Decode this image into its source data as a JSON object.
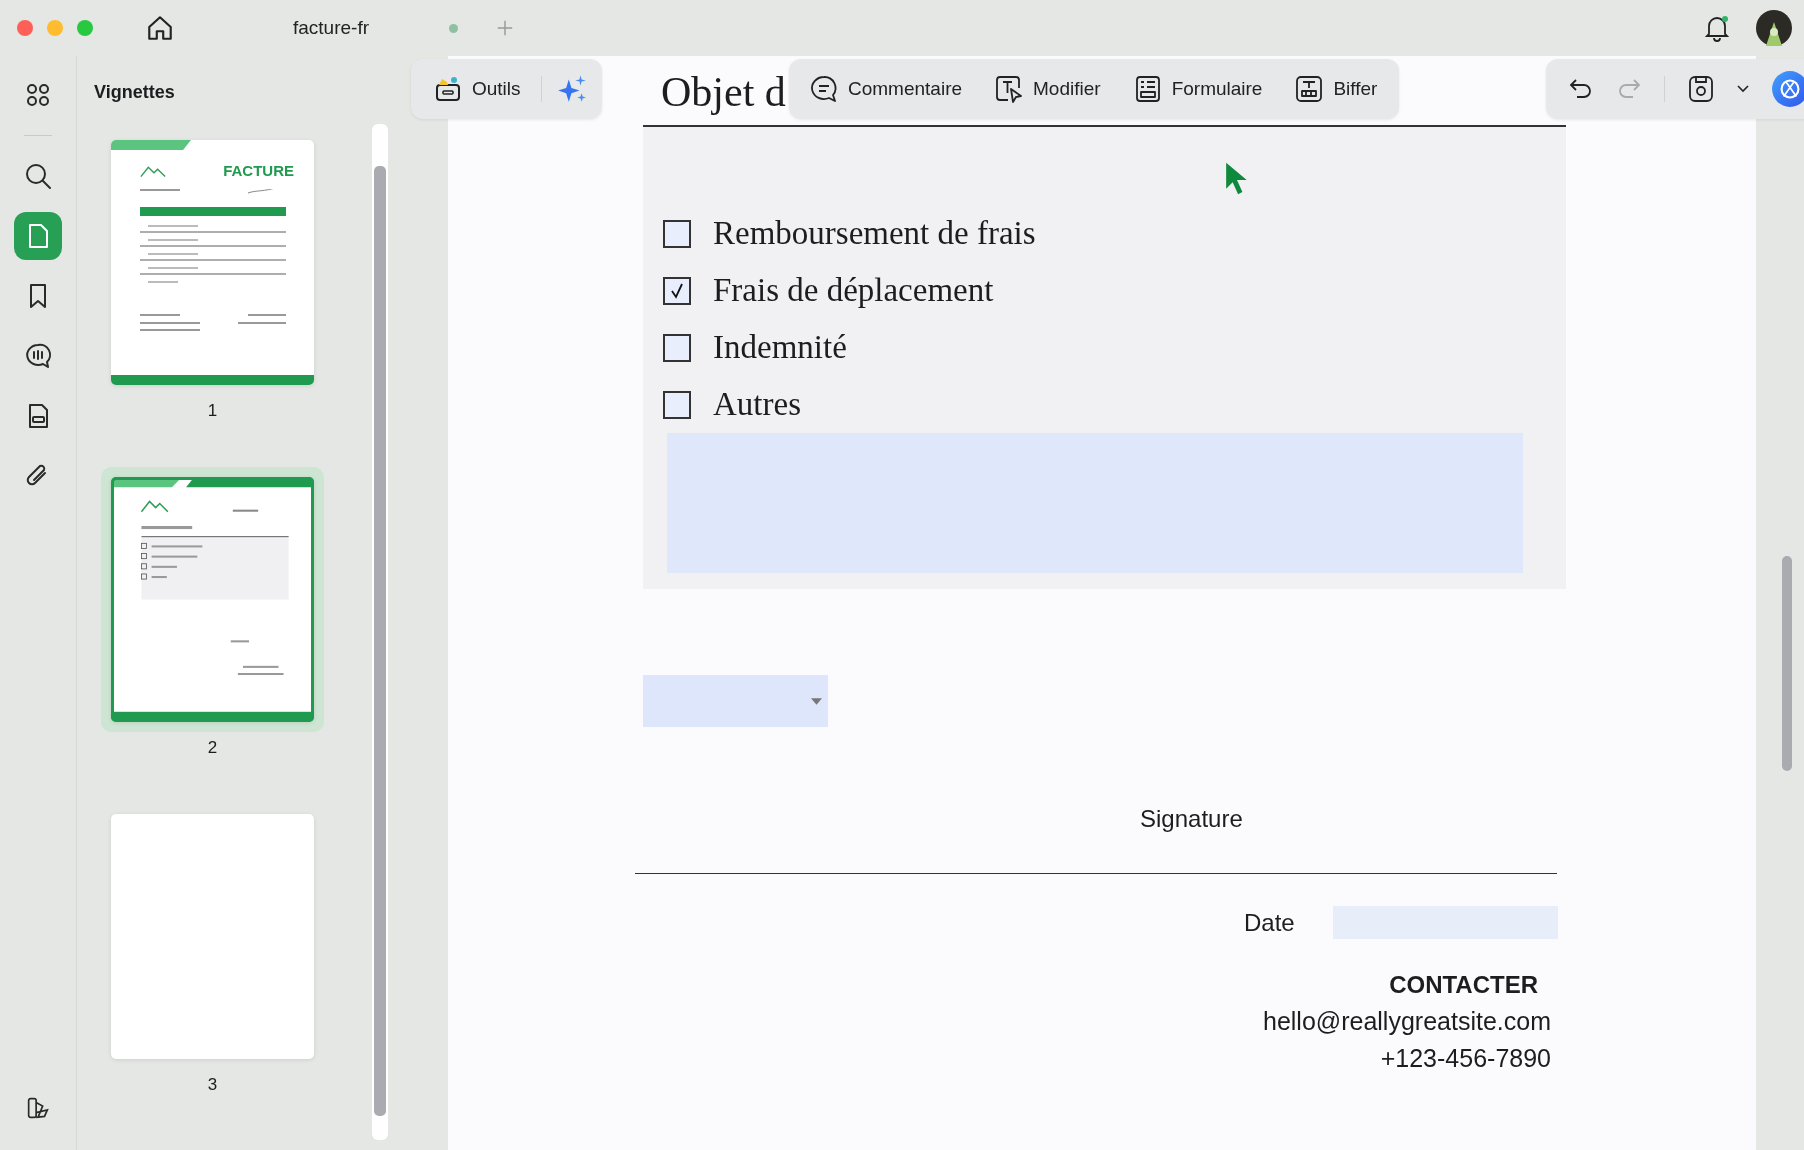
{
  "window": {
    "tab_title": "facture-fr",
    "tab_unsaved": true
  },
  "rail": [
    {
      "kind": "grid",
      "selected": false
    },
    {
      "kind": "search",
      "selected": false
    },
    {
      "kind": "page",
      "selected": true
    },
    {
      "kind": "bookmark",
      "selected": false
    },
    {
      "kind": "comment",
      "selected": false
    },
    {
      "kind": "form",
      "selected": false
    },
    {
      "kind": "attachment",
      "selected": false
    }
  ],
  "sidebar": {
    "title": "Vignettes",
    "thumbnails": [
      {
        "page": "1",
        "kind": "invoice",
        "title": "FACTURE",
        "selected": false
      },
      {
        "page": "2",
        "kind": "form",
        "selected": true
      },
      {
        "page": "3",
        "kind": "blank",
        "selected": false
      }
    ]
  },
  "toolbar": {
    "tools_label": "Outils",
    "modes": [
      {
        "kind": "comment",
        "label": "Commentaire"
      },
      {
        "kind": "edit",
        "label": "Modifier"
      },
      {
        "kind": "form",
        "label": "Formulaire"
      },
      {
        "kind": "redact",
        "label": "Biffer"
      }
    ]
  },
  "document": {
    "heading": "Objet d",
    "options": [
      {
        "label": "Remboursement de frais",
        "checked": false
      },
      {
        "label": "Frais de déplacement",
        "checked": true
      },
      {
        "label": "Indemnité",
        "checked": false
      },
      {
        "label": "Autres",
        "checked": false
      }
    ],
    "signature_label": "Signature",
    "date_label": "Date",
    "contact": {
      "title": "CONTACTER",
      "email": "hello@reallygreatsite.com",
      "phone": "+123-456-7890"
    }
  }
}
